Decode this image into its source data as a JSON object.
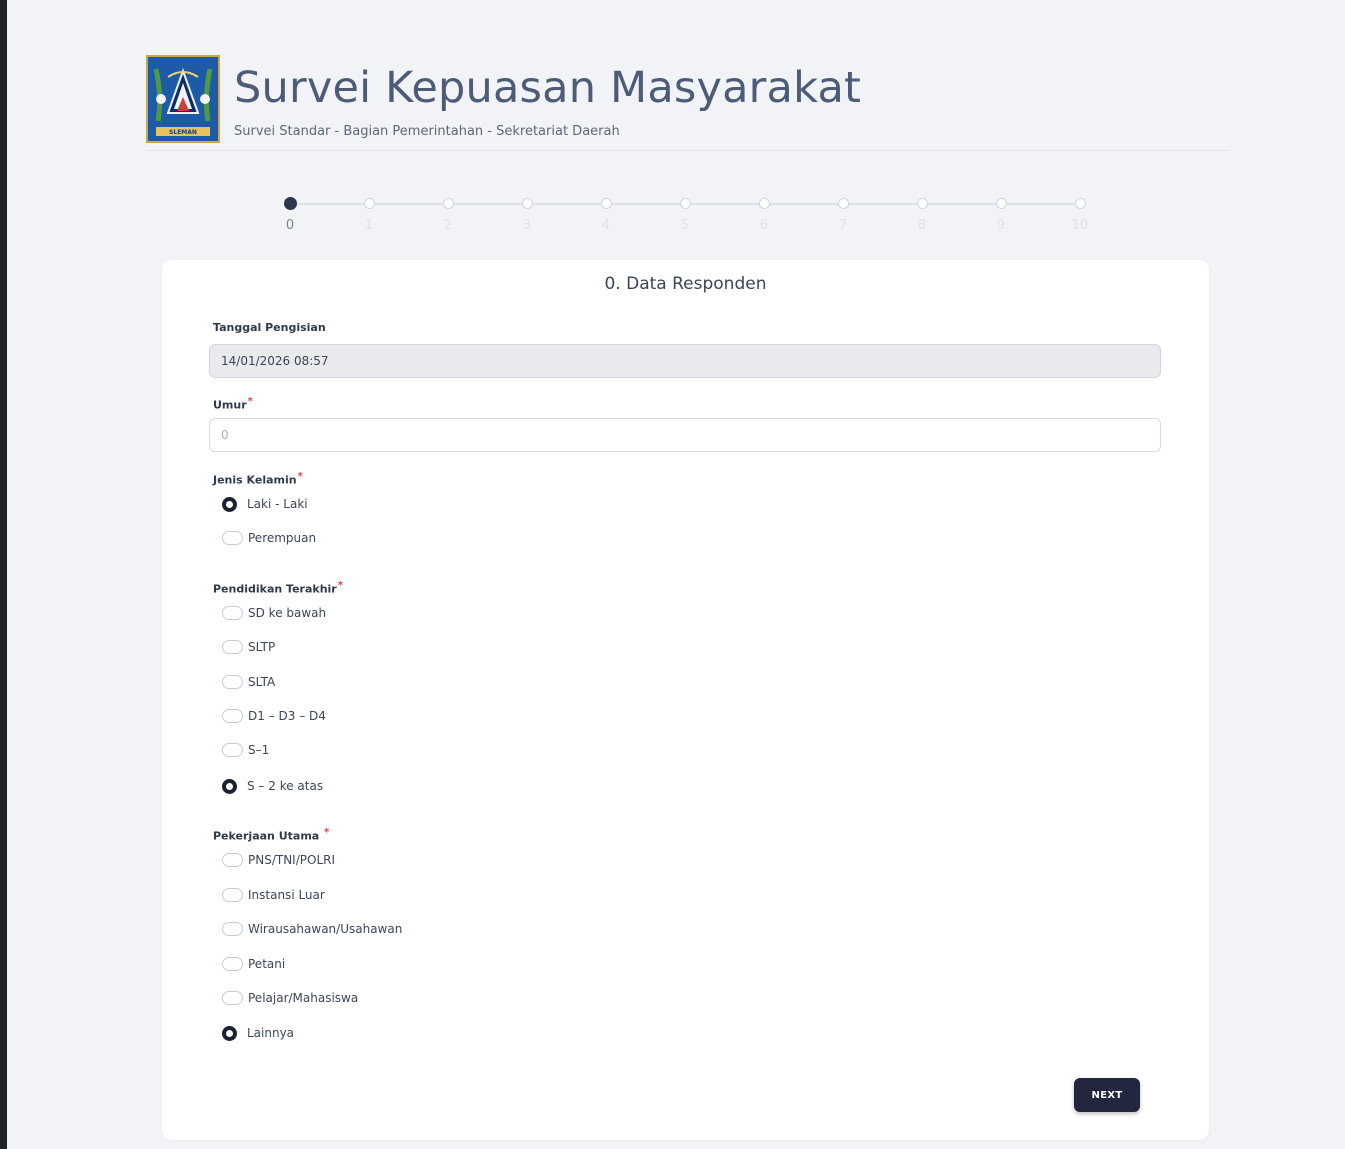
{
  "header": {
    "title": "Survei Kepuasan Masyarakat",
    "subtitle": "Survei Standar - Bagian Pemerintahan - Sekretariat Daerah",
    "logo_text": "SLEMAN"
  },
  "stepper": {
    "steps": [
      "0",
      "1",
      "2",
      "3",
      "4",
      "5",
      "6",
      "7",
      "8",
      "9",
      "10"
    ],
    "active_step": 0
  },
  "form": {
    "section_title": "0. Data Responden",
    "tanggal": {
      "label": "Tanggal Pengisian",
      "value": "14/01/2026 08:57"
    },
    "umur": {
      "label": "Umur",
      "required_mark": "*",
      "value": "",
      "placeholder": "0"
    },
    "jenis_kelamin": {
      "label": "Jenis Kelamin",
      "required_mark": "*",
      "options": [
        "Laki - Laki",
        "Perempuan"
      ],
      "selected": "Laki - Laki"
    },
    "pendidikan": {
      "label": "Pendidikan Terakhir",
      "required_mark": "*",
      "options": [
        "SD ke bawah",
        "SLTP",
        "SLTA",
        "D1 – D3 – D4",
        "S–1",
        "S – 2 ke atas"
      ],
      "selected": "S – 2 ke atas"
    },
    "pekerjaan": {
      "label": "Pekerjaan Utama",
      "required_mark": "*",
      "options": [
        "PNS/TNI/POLRI",
        "Instansi Luar",
        "Wirausahawan/Usahawan",
        "Petani",
        "Pelajar/Mahasiswa",
        "Lainnya"
      ],
      "selected": "Lainnya"
    },
    "next_label": "NEXT"
  },
  "colors": {
    "accent": "#22273f",
    "active_step": "#2c3650",
    "required": "#d8434a",
    "background": "#f1f3f6"
  }
}
